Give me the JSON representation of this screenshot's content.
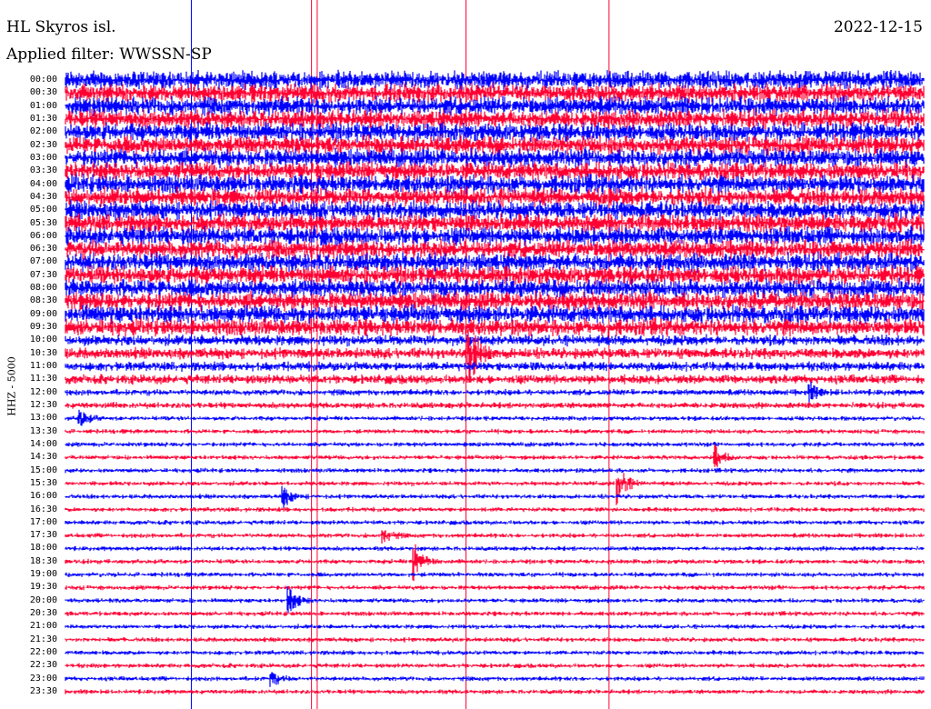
{
  "header": {
    "station": "HL Skyros isl.",
    "filter": "Applied filter: WWSSN-SP",
    "date": "2022-12-15",
    "channel": "HHZ - 5000"
  },
  "colors": {
    "blue": "#0000ff",
    "red": "#ff0033"
  },
  "chart_data": {
    "type": "line",
    "title": "HL Skyros isl. 2022-12-15",
    "subtitle": "Applied filter: WWSSN-SP",
    "ylabel": "HHZ - 5000",
    "row_minutes": 30,
    "row_labels": [
      "00:00",
      "00:30",
      "01:00",
      "01:30",
      "02:00",
      "02:30",
      "03:00",
      "03:30",
      "04:00",
      "04:30",
      "05:00",
      "05:30",
      "06:00",
      "06:30",
      "07:00",
      "07:30",
      "08:00",
      "08:30",
      "09:00",
      "09:30",
      "10:00",
      "10:30",
      "11:00",
      "11:30",
      "12:00",
      "12:30",
      "13:00",
      "13:30",
      "14:00",
      "14:30",
      "15:00",
      "15:30",
      "16:00",
      "16:30",
      "17:00",
      "17:30",
      "18:00",
      "18:30",
      "19:00",
      "19:30",
      "20:00",
      "20:30",
      "21:00",
      "21:30",
      "22:00",
      "22:30",
      "23:00",
      "23:30"
    ],
    "series_colors_alternate": [
      "blue",
      "red"
    ],
    "noise_level_by_row": [
      12,
      12,
      12,
      12,
      12,
      12,
      12,
      12,
      12,
      12,
      12,
      12,
      12,
      12,
      12,
      12,
      12,
      12,
      12,
      11,
      7,
      7,
      6,
      6,
      4,
      4,
      3,
      3,
      3,
      3,
      3,
      3,
      3,
      3,
      3,
      3,
      3,
      3,
      3,
      3,
      3,
      3,
      3,
      3,
      3,
      3,
      3,
      3
    ],
    "events": [
      {
        "row": 21,
        "minute": 14.1,
        "amplitude": 40
      },
      {
        "row": 24,
        "minute": 26.0,
        "amplitude": 10
      },
      {
        "row": 26,
        "minute": 0.5,
        "amplitude": 10
      },
      {
        "row": 29,
        "minute": 22.7,
        "amplitude": 14
      },
      {
        "row": 31,
        "minute": 19.3,
        "amplitude": 24
      },
      {
        "row": 32,
        "minute": 7.6,
        "amplitude": 12
      },
      {
        "row": 35,
        "minute": 11.1,
        "amplitude": 10
      },
      {
        "row": 37,
        "minute": 12.2,
        "amplitude": 22
      },
      {
        "row": 40,
        "minute": 7.8,
        "amplitude": 16
      },
      {
        "row": 46,
        "minute": 7.2,
        "amplitude": 8
      }
    ],
    "spikes_minute": [
      4.4,
      8.6,
      8.8,
      14.0,
      19.0
    ]
  }
}
